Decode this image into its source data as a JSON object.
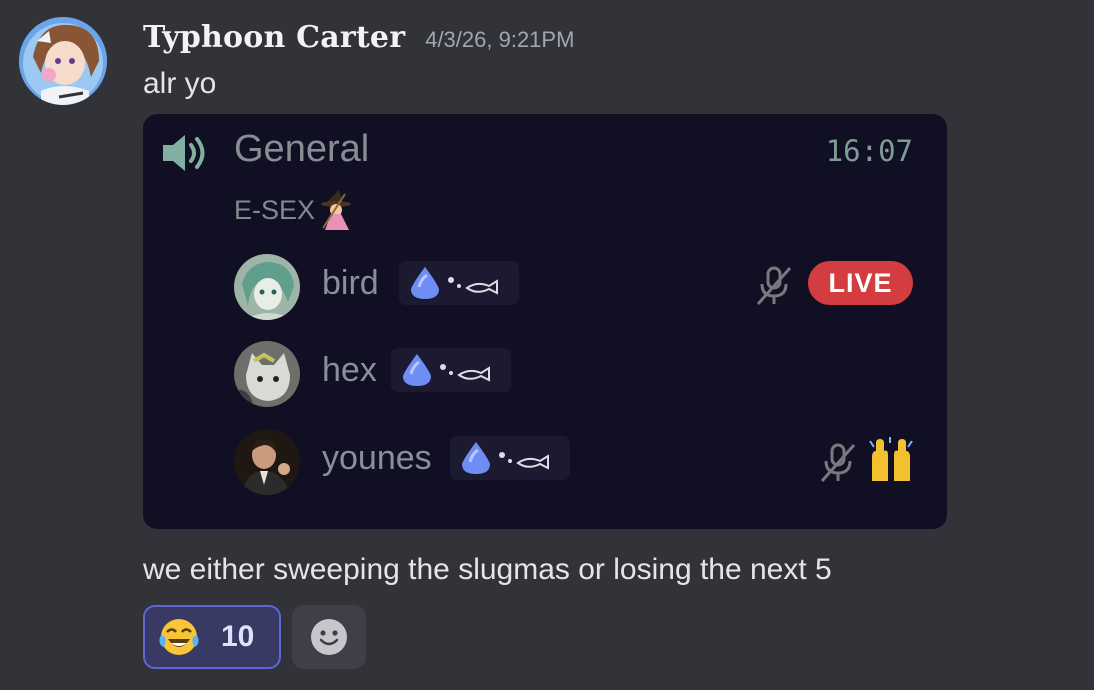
{
  "message": {
    "author": "Typhoon Carter",
    "timestamp": "4/3/26, 9:21PM",
    "line1": "alr yo",
    "line2": "we either sweeping the slugmas or losing the next 5"
  },
  "voice_card": {
    "channel_icon": "speaker-icon",
    "channel_name": "General",
    "elapsed": "16:07",
    "status_text": "E-SEX",
    "status_emoji": "witch-emoji",
    "members": [
      {
        "name": "bird",
        "tag_icons": [
          "blue-drop-icon",
          "fish-icon"
        ],
        "muted": true,
        "live": true,
        "live_label": "LIVE",
        "hand_raised": false
      },
      {
        "name": "hex",
        "tag_icons": [
          "blue-drop-icon",
          "fish-icon"
        ],
        "muted": false,
        "live": false,
        "hand_raised": false
      },
      {
        "name": "younes",
        "tag_icons": [
          "blue-drop-icon",
          "fish-icon"
        ],
        "muted": true,
        "live": false,
        "hand_raised": true,
        "hand_icon": "raising-hands-emoji"
      }
    ]
  },
  "reactions": [
    {
      "emoji": "tears-of-joy-emoji",
      "count": "10",
      "selected": true
    }
  ],
  "add_reaction_icon": "smiley-add-reaction-icon",
  "colors": {
    "background": "#323339",
    "card": "#110f24",
    "live": "#d43d3f",
    "reaction_selected_border": "#5f66d6",
    "reaction_selected_bg": "#393a63",
    "speaker_teal": "#7fb0a0"
  }
}
